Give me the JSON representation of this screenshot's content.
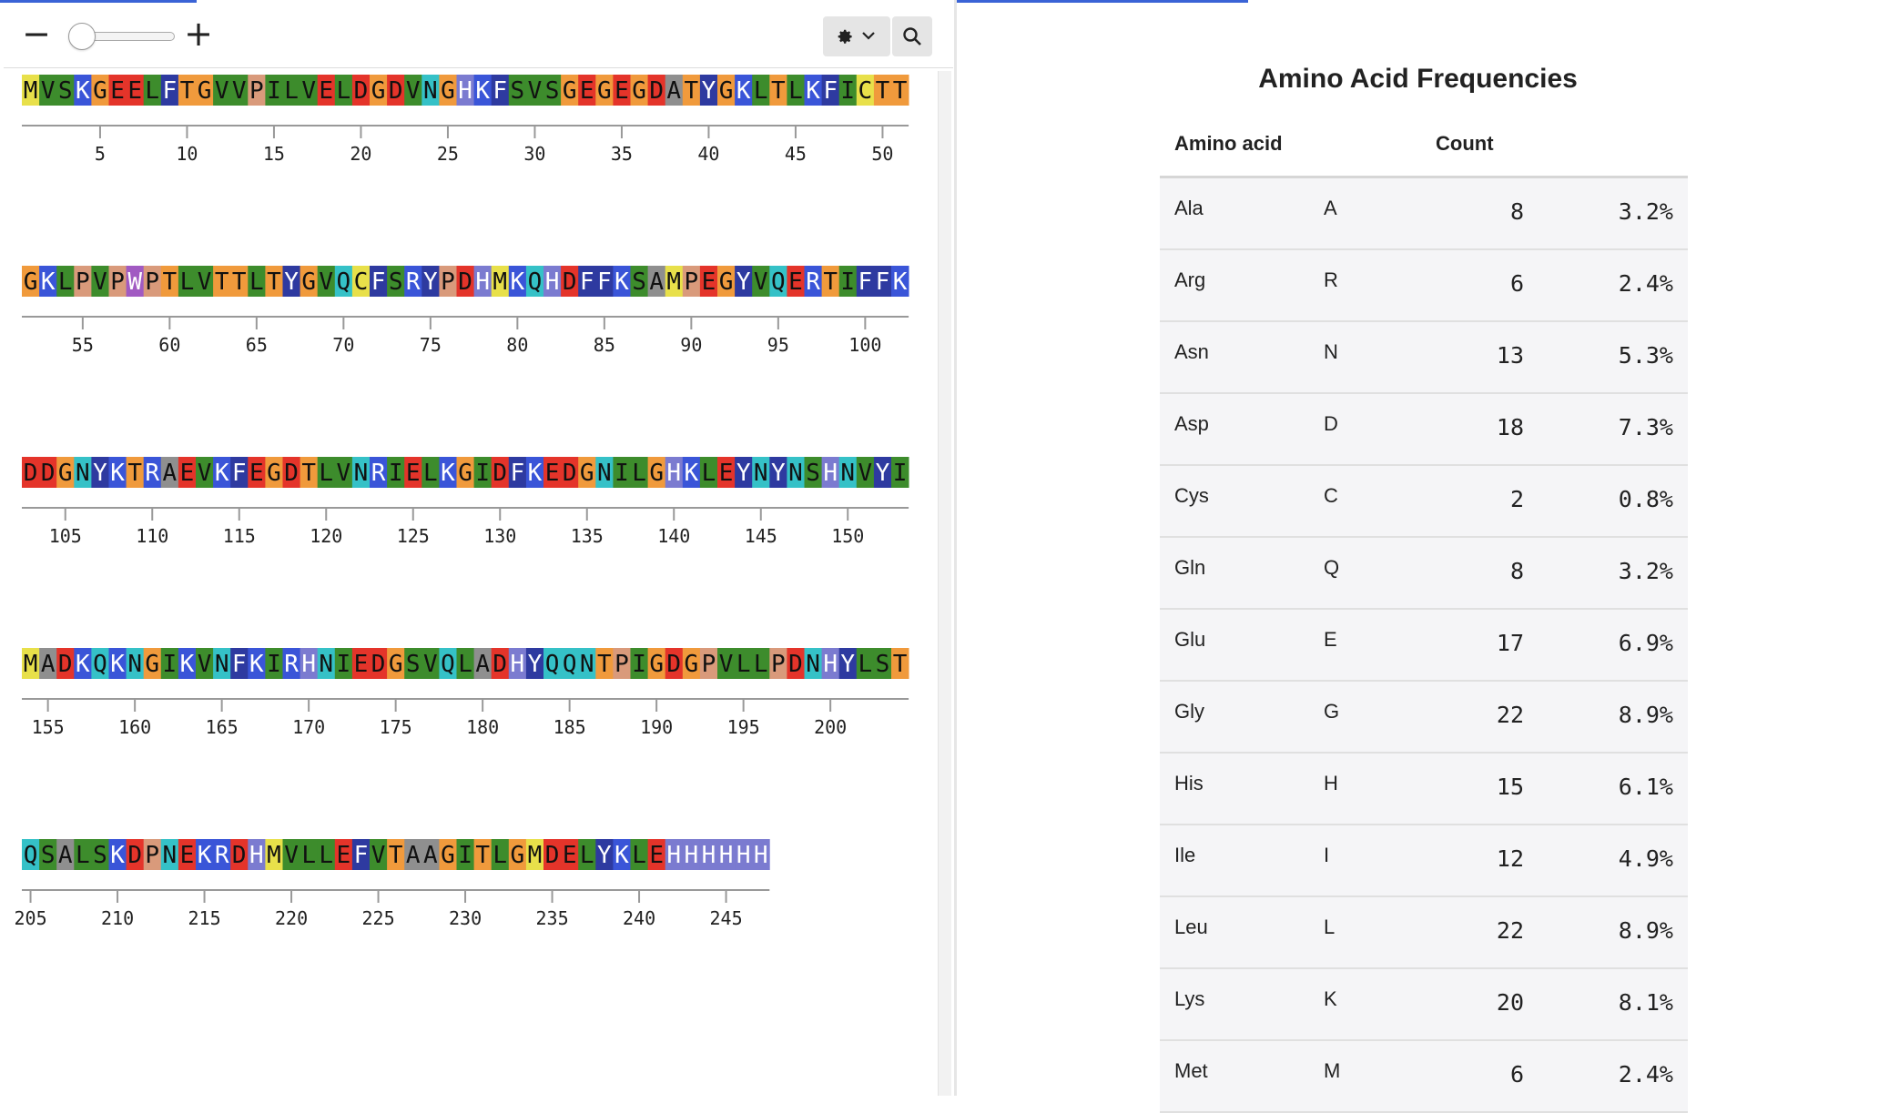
{
  "toolbar": {
    "zoom_out": "−",
    "zoom_in": "+",
    "zoom_level": 0.1,
    "gear_icon": "gear-icon",
    "chevron_icon": "chevron-down-icon",
    "search_icon": "search-icon"
  },
  "sequence": {
    "rows": [
      {
        "seq": "MVSKGEELFTGVVPILVELDGDVNGHKFSVSGEGEGDATYGKLTLKFICTT",
        "start": 1,
        "ticks": [
          "5",
          "10",
          "15",
          "20",
          "25",
          "30",
          "35",
          "40",
          "45",
          "50"
        ]
      },
      {
        "seq": "GKLPVPWPTLVTTLTYGVQCFSRYPDHMKQHDFFKSAMPEGYVQERTIFFK",
        "start": 52,
        "ticks": [
          "55",
          "60",
          "65",
          "70",
          "75",
          "80",
          "85",
          "90",
          "95",
          "100"
        ]
      },
      {
        "seq": "DDGNYKTRAEVKFEGDTLVNRIELKGIDFKEDGNILGHKLEYNYNSHNVYI",
        "start": 103,
        "ticks": [
          "105",
          "110",
          "115",
          "120",
          "125",
          "130",
          "135",
          "140",
          "145",
          "150"
        ]
      },
      {
        "seq": "MADKQKNGIKVNFKIRHNIEDGSVQLADHYQQNTPIGDGPVLLPDNHYLST",
        "start": 154,
        "ticks": [
          "155",
          "160",
          "165",
          "170",
          "175",
          "180",
          "185",
          "190",
          "195",
          "200"
        ]
      },
      {
        "seq": "QSALSKDPNEKRDHMVLLEFVTAAGITLGMDELYKLEHHHHHH",
        "start": 205,
        "ticks": [
          "205",
          "210",
          "215",
          "220",
          "225",
          "230",
          "235",
          "240",
          "245"
        ]
      }
    ]
  },
  "aa_colors": {
    "A": "#8f8f8f",
    "R": "#3a55d8",
    "N": "#35c1c7",
    "D": "#e4342a",
    "C": "#e8e04a",
    "Q": "#35c1c7",
    "E": "#e4342a",
    "G": "#f09a3c",
    "H": "#7b7bd0",
    "I": "#3d8c2c",
    "L": "#3d8c2c",
    "K": "#3a55d8",
    "M": "#e8e04a",
    "F": "#2e3aa0",
    "P": "#d99a7b",
    "S": "#3d8c2c",
    "T": "#f09a3c",
    "W": "#a15ac2",
    "Y": "#2e3aa0",
    "V": "#3d8c2c"
  },
  "frequencies": {
    "title": "Amino Acid Frequencies",
    "col_amino": "Amino acid",
    "col_count": "Count",
    "rows": [
      {
        "name": "Ala",
        "code": "A",
        "count": "8",
        "pct": "3.2%"
      },
      {
        "name": "Arg",
        "code": "R",
        "count": "6",
        "pct": "2.4%"
      },
      {
        "name": "Asn",
        "code": "N",
        "count": "13",
        "pct": "5.3%"
      },
      {
        "name": "Asp",
        "code": "D",
        "count": "18",
        "pct": "7.3%"
      },
      {
        "name": "Cys",
        "code": "C",
        "count": "2",
        "pct": "0.8%"
      },
      {
        "name": "Gln",
        "code": "Q",
        "count": "8",
        "pct": "3.2%"
      },
      {
        "name": "Glu",
        "code": "E",
        "count": "17",
        "pct": "6.9%"
      },
      {
        "name": "Gly",
        "code": "G",
        "count": "22",
        "pct": "8.9%"
      },
      {
        "name": "His",
        "code": "H",
        "count": "15",
        "pct": "6.1%"
      },
      {
        "name": "Ile",
        "code": "I",
        "count": "12",
        "pct": "4.9%"
      },
      {
        "name": "Leu",
        "code": "L",
        "count": "22",
        "pct": "8.9%"
      },
      {
        "name": "Lys",
        "code": "K",
        "count": "20",
        "pct": "8.1%"
      },
      {
        "name": "Met",
        "code": "M",
        "count": "6",
        "pct": "2.4%"
      }
    ]
  }
}
